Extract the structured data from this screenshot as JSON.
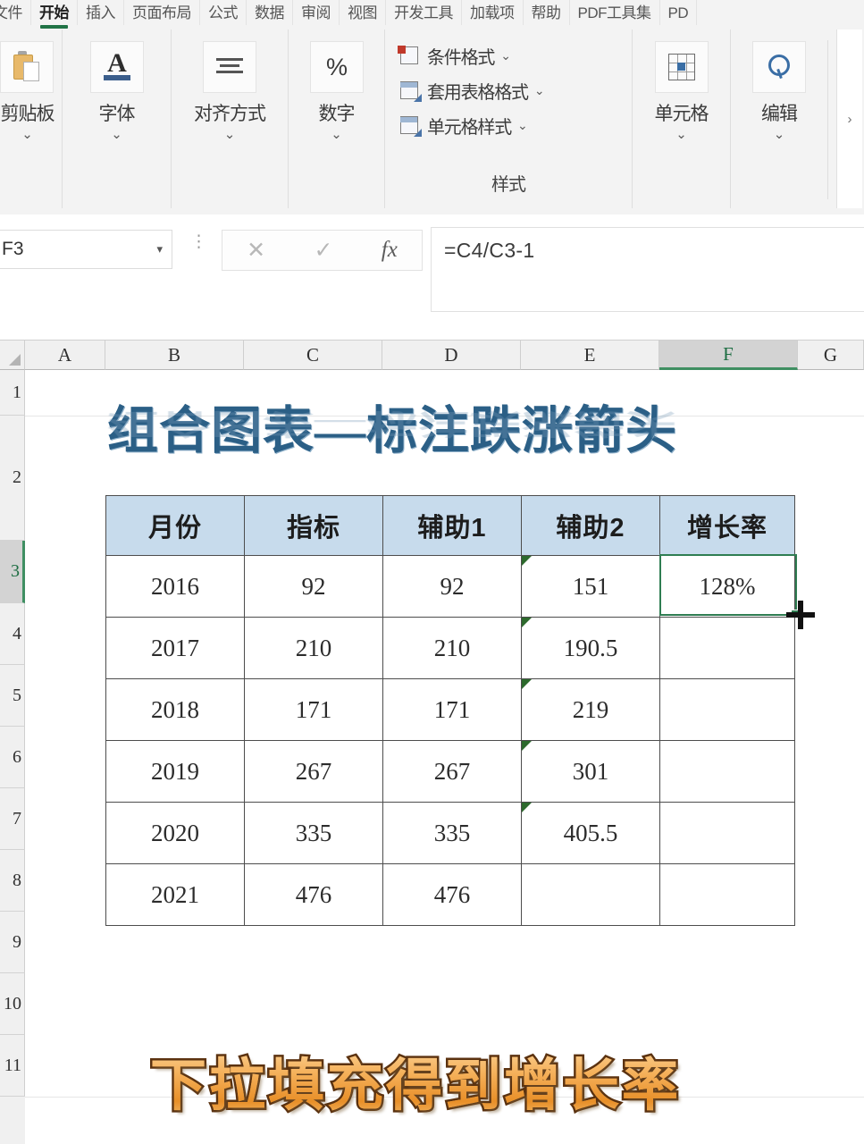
{
  "ribbon": {
    "tabs": [
      {
        "label": "文件",
        "active": false
      },
      {
        "label": "开始",
        "active": true
      },
      {
        "label": "插入",
        "active": false
      },
      {
        "label": "页面布局",
        "active": false
      },
      {
        "label": "公式",
        "active": false
      },
      {
        "label": "数据",
        "active": false
      },
      {
        "label": "审阅",
        "active": false
      },
      {
        "label": "视图",
        "active": false
      },
      {
        "label": "开发工具",
        "active": false
      },
      {
        "label": "加载项",
        "active": false
      },
      {
        "label": "帮助",
        "active": false
      },
      {
        "label": "PDF工具集",
        "active": false
      },
      {
        "label": "PD",
        "active": false
      }
    ],
    "groups": {
      "clipboard": {
        "label": "剪贴板",
        "caret": "⌄",
        "icon": "clipboard-paste-icon"
      },
      "font": {
        "label": "字体",
        "caret": "⌄",
        "icon": "font-A-icon"
      },
      "alignment": {
        "label": "对齐方式",
        "caret": "⌄",
        "icon": "align-center-icon"
      },
      "number": {
        "label": "数字",
        "caret": "⌄",
        "icon": "percent-icon",
        "glyph": "%"
      },
      "styles": {
        "caption": "样式",
        "items": [
          {
            "label": "条件格式",
            "caret": "⌄",
            "icon": "conditional-formatting-icon"
          },
          {
            "label": "套用表格格式",
            "caret": "⌄",
            "icon": "format-as-table-icon"
          },
          {
            "label": "单元格样式",
            "caret": "⌄",
            "icon": "cell-styles-icon"
          }
        ]
      },
      "cells": {
        "label": "单元格",
        "caret": "⌄",
        "icon": "insert-cells-icon"
      },
      "editing": {
        "label": "编辑",
        "caret": "⌄",
        "icon": "find-select-icon"
      }
    },
    "overflow_caret": "›"
  },
  "formula_bar": {
    "name_box_value": "F3",
    "name_box_caret": "▾",
    "drag_handle": "⋮",
    "cancel_icon": "✕",
    "enter_icon": "✓",
    "fx_icon": "fx",
    "formula": "=C4/C3-1"
  },
  "sheet": {
    "column_headers": [
      "A",
      "B",
      "C",
      "D",
      "E",
      "F",
      "G"
    ],
    "selected_column": "F",
    "row_headers": [
      "1",
      "2",
      "3",
      "4",
      "5",
      "6",
      "7",
      "8",
      "9",
      "10",
      "11"
    ],
    "selected_row": "3",
    "selected_cell": "F3",
    "cursor": "fill-handle-plus"
  },
  "content": {
    "title": "组合图表—标注跌涨箭头",
    "caption": "下拉填充得到增长率"
  },
  "table": {
    "headers": [
      "月份",
      "指标",
      "辅助1",
      "辅助2",
      "增长率"
    ],
    "rows": [
      {
        "cells": [
          "2016",
          "92",
          "92",
          "151",
          "128%"
        ],
        "error_flag_col": 3
      },
      {
        "cells": [
          "2017",
          "210",
          "210",
          "190.5",
          ""
        ],
        "error_flag_col": 3
      },
      {
        "cells": [
          "2018",
          "171",
          "171",
          "219",
          ""
        ],
        "error_flag_col": 3
      },
      {
        "cells": [
          "2019",
          "267",
          "267",
          "301",
          ""
        ],
        "error_flag_col": 3
      },
      {
        "cells": [
          "2020",
          "335",
          "335",
          "405.5",
          ""
        ],
        "error_flag_col": 3
      },
      {
        "cells": [
          "2021",
          "476",
          "476",
          "",
          ""
        ],
        "error_flag_col": -1
      }
    ]
  },
  "colors": {
    "accent_green": "#217346",
    "header_fill": "#c7dbec",
    "title_blue": "#2b5f86",
    "caption_orange": "#f0a851",
    "caption_outline": "#5b3210",
    "error_triangle": "#2d6a2d"
  }
}
